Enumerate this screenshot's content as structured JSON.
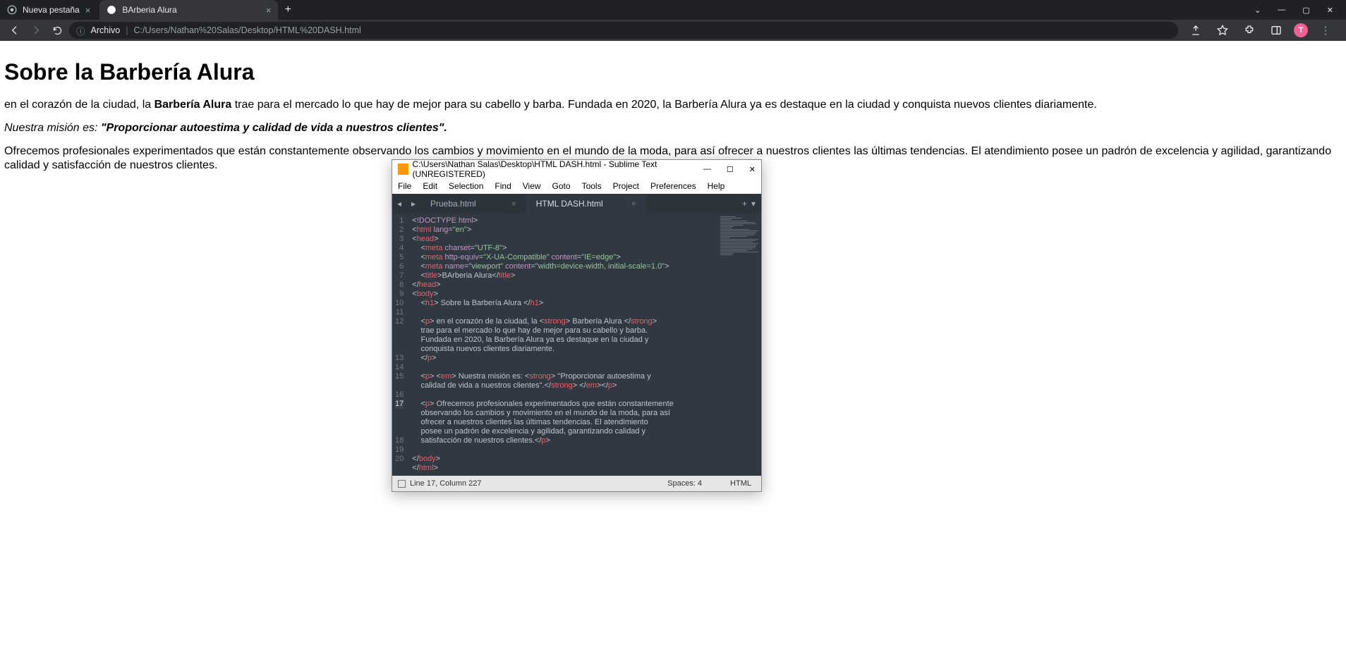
{
  "chrome": {
    "tabs": {
      "inactive_title": "Nueva pestaña",
      "active_title": "BArberia Alura"
    },
    "address": {
      "scheme_icon_label": "ⓘ",
      "scheme_label": "Archivo",
      "path": "C:/Users/Nathan%20Salas/Desktop/HTML%20DASH.html"
    },
    "profile_letter": "T"
  },
  "page": {
    "h1": "Sobre la Barbería Alura",
    "p1_pre": "en el corazón de la ciudad, la ",
    "p1_strong": "Barbería Alura",
    "p1_post": " trae para el mercado lo que hay de mejor para su cabello y barba. Fundada en 2020, la Barbería Alura ya es destaque en la ciudad y conquista nuevos clientes diariamente.",
    "p2_em_pre": "Nuestra misión es: ",
    "p2_em_strong": "\"Proporcionar autoestima y calidad de vida a nuestros clientes\".",
    "p3": "Ofrecemos profesionales experimentados que están constantemente observando los cambios y movimiento en el mundo de la moda, para así ofrecer a nuestros clientes las últimas tendencias. El atendimiento posee un padrón de excelencia y agilidad, garantizando calidad y satisfacción de nuestros clientes."
  },
  "sublime": {
    "title": "C:\\Users\\Nathan Salas\\Desktop\\HTML DASH.html - Sublime Text (UNREGISTERED)",
    "menu": {
      "file": "File",
      "edit": "Edit",
      "selection": "Selection",
      "find": "Find",
      "view": "View",
      "goto": "Goto",
      "tools": "Tools",
      "project": "Project",
      "prefs": "Preferences",
      "help": "Help"
    },
    "tabs": {
      "inactive": "Prueba.html",
      "active": "HTML DASH.html"
    },
    "status": {
      "cursor": "Line 17, Column 227",
      "spaces": "Spaces: 4",
      "syntax": "HTML"
    },
    "line_numbers": [
      "1",
      "2",
      "3",
      "4",
      "5",
      "6",
      "7",
      "8",
      "9",
      "10",
      "11",
      "12",
      "",
      "",
      "",
      "13",
      "14",
      "15",
      "",
      "16",
      "17",
      "",
      "",
      "",
      "18",
      "19",
      "20"
    ],
    "highlight_line_index": 20
  }
}
